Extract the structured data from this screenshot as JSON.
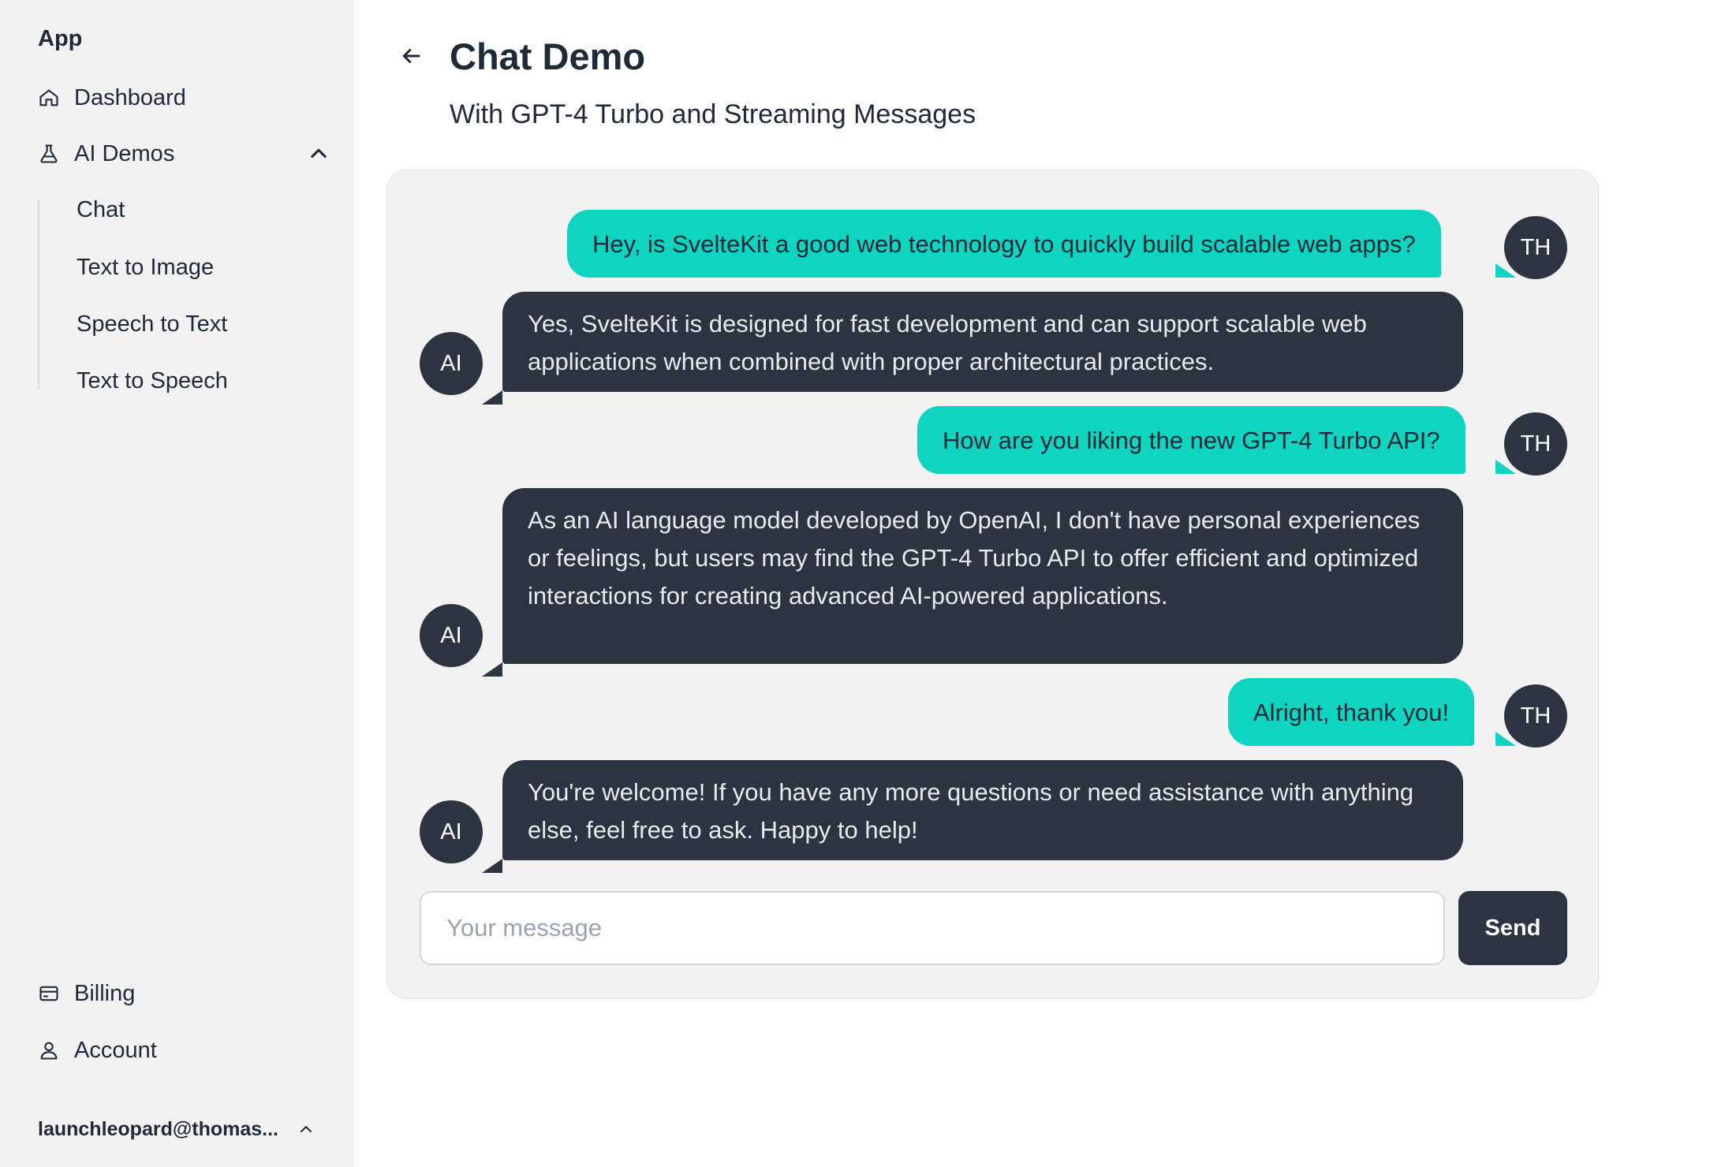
{
  "sidebar": {
    "app_title": "App",
    "nav": {
      "dashboard": "Dashboard",
      "ai_demos": "AI Demos",
      "billing": "Billing",
      "account": "Account"
    },
    "ai_demos_items": [
      "Chat",
      "Text to Image",
      "Speech to Text",
      "Text to Speech"
    ],
    "user_email": "launchleopard@thomas..."
  },
  "header": {
    "title": "Chat Demo",
    "subtitle": "With GPT-4 Turbo and Streaming Messages"
  },
  "chat": {
    "user_initials": "TH",
    "ai_initials": "AI",
    "messages": [
      {
        "role": "user",
        "text": "Hey, is SvelteKit a good web technology to quickly build scalable web apps?"
      },
      {
        "role": "ai",
        "text": "Yes, SvelteKit is designed for fast development and can support scalable web applications when combined with proper architectural practices."
      },
      {
        "role": "user",
        "text": "How are you liking the new GPT-4 Turbo API?"
      },
      {
        "role": "ai",
        "text": "As an AI language model developed by OpenAI, I don't have personal experiences or feelings, but users may find the GPT-4 Turbo API to offer efficient and optimized interactions for creating advanced AI-powered applications."
      },
      {
        "role": "user",
        "text": "Alright, thank you!"
      },
      {
        "role": "ai",
        "text": "You're welcome! If you have any more questions or need assistance with anything else, feel free to ask. Happy to help!"
      }
    ],
    "input": {
      "value": "",
      "placeholder": "Your message"
    },
    "send_label": "Send"
  },
  "colors": {
    "sidebar_bg": "#f2f2f2",
    "user_bubble": "#0fd4c0",
    "ai_bubble": "#2d3441",
    "send_button": "#2d3441"
  }
}
